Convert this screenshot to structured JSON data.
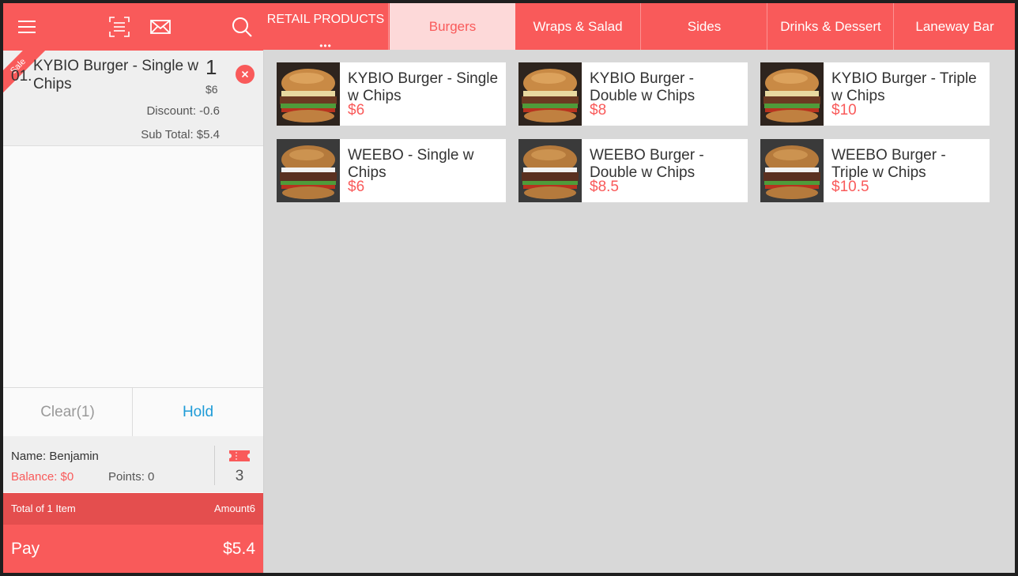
{
  "toolbar": {
    "icons": [
      "menu-icon",
      "scan-icon",
      "mail-icon",
      "search-icon"
    ]
  },
  "cart": {
    "items": [
      {
        "badge": "Sale",
        "index": "01.",
        "name": "KYBIO Burger - Single w Chips",
        "qty": "1",
        "price": "$6",
        "discount": "Discount: -0.6",
        "subtotal": "Sub Total: $5.4"
      }
    ]
  },
  "actions": {
    "clear_label": "Clear(1)",
    "hold_label": "Hold"
  },
  "member": {
    "name": "Name: Benjamin",
    "balance": "Balance: $0",
    "points": "Points: 0",
    "coupon_count": "3"
  },
  "totals": {
    "label": "Total of 1 Item",
    "amount": "Amount6"
  },
  "pay": {
    "label": "Pay",
    "amount": "$5.4"
  },
  "tabs": [
    {
      "label": "RETAIL PRODUCTS",
      "active": false,
      "more": "•••"
    },
    {
      "label": "Burgers",
      "active": true
    },
    {
      "label": "Wraps & Salad",
      "active": false
    },
    {
      "label": "Sides",
      "active": false
    },
    {
      "label": "Drinks & Dessert",
      "active": false
    },
    {
      "label": "Laneway Bar",
      "active": false
    }
  ],
  "products": [
    {
      "name": "KYBIO Burger - Single w Chips",
      "price": "$6"
    },
    {
      "name": "KYBIO Burger - Double w Chips",
      "price": "$8"
    },
    {
      "name": "KYBIO Burger - Triple w Chips",
      "price": "$10"
    },
    {
      "name": "WEEBO - Single w Chips",
      "price": "$6"
    },
    {
      "name": "WEEBO Burger - Double w Chips",
      "price": "$8.5"
    },
    {
      "name": "WEEBO Burger - Triple w Chips",
      "price": "$10.5"
    }
  ],
  "colors": {
    "accent": "#f95a5a",
    "accent_dark": "#e44e4e",
    "active_tab_bg": "#fdd9d9",
    "hold_blue": "#1e9bd7",
    "grid_bg": "#d8d8d8"
  }
}
